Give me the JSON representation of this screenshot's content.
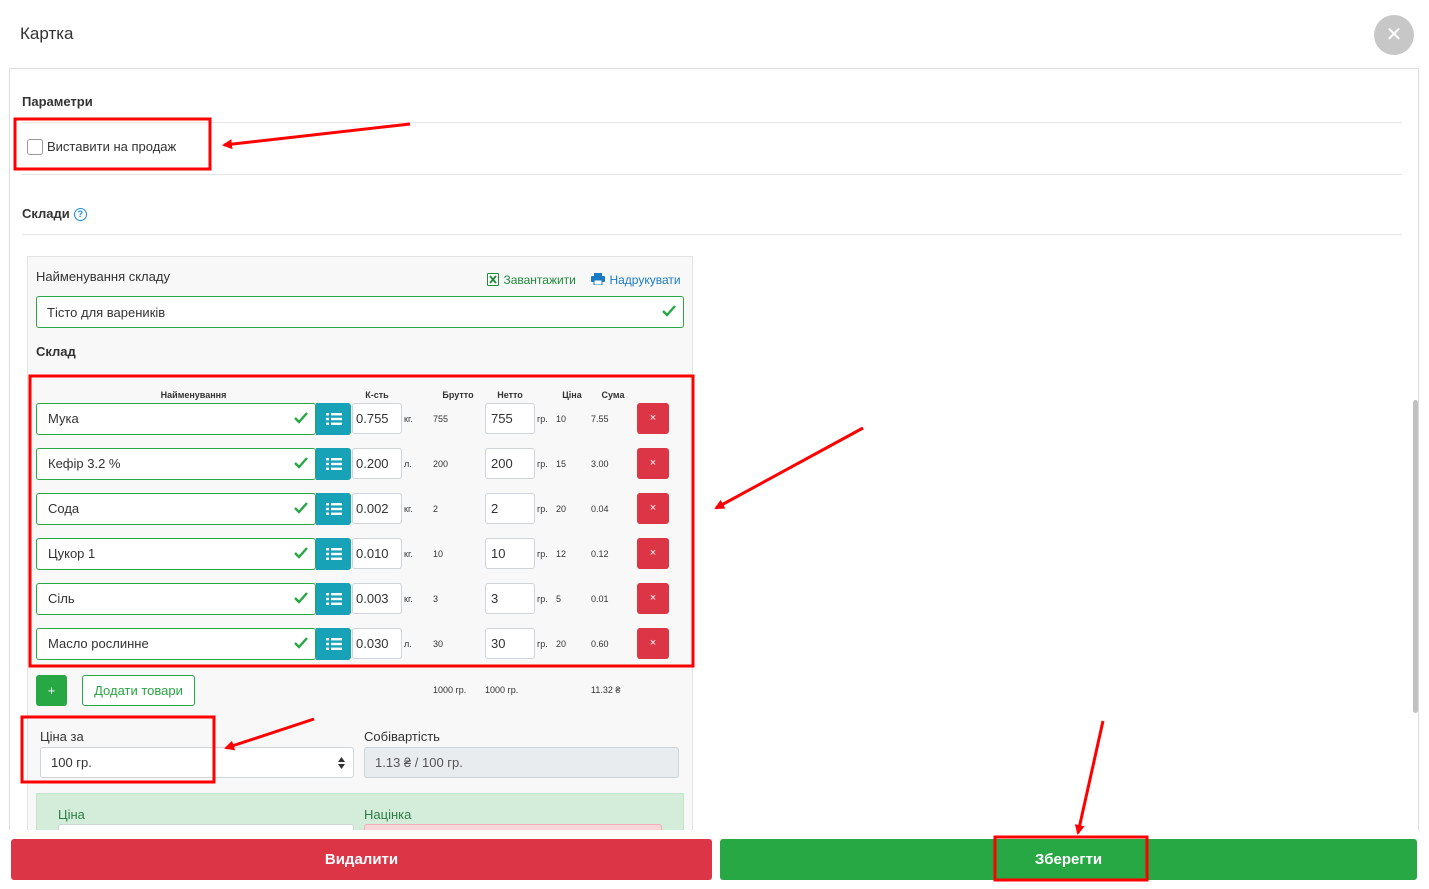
{
  "modal": {
    "title": "Картка",
    "close_icon": "close-icon"
  },
  "params": {
    "title": "Параметри",
    "for_sale_label": "Виставити на продаж",
    "for_sale_checked": false
  },
  "stores": {
    "title": "Склади",
    "card": {
      "name_label": "Найменування складу",
      "download_label": "Завантажити",
      "print_label": "Надрукувати",
      "name_value": "Тісто для вареників",
      "composition_label": "Склад",
      "headers": {
        "name": "Найменування",
        "qty": "К-сть",
        "gross": "Брутто",
        "net": "Нетто",
        "price": "Ціна",
        "sum": "Сума"
      },
      "rows": [
        {
          "name": "Мука",
          "qty": "0.755",
          "unit": "кг.",
          "gross": "755",
          "net": "755",
          "net_unit": "гр.",
          "price": "10",
          "sum": "7.55"
        },
        {
          "name": "Кефір 3.2 %",
          "qty": "0.200",
          "unit": "л.",
          "gross": "200",
          "net": "200",
          "net_unit": "гр.",
          "price": "15",
          "sum": "3.00"
        },
        {
          "name": "Сода",
          "qty": "0.002",
          "unit": "кг.",
          "gross": "2",
          "net": "2",
          "net_unit": "гр.",
          "price": "20",
          "sum": "0.04"
        },
        {
          "name": "Цукор 1",
          "qty": "0.010",
          "unit": "кг.",
          "gross": "10",
          "net": "10",
          "net_unit": "гр.",
          "price": "12",
          "sum": "0.12"
        },
        {
          "name": "Сіль",
          "qty": "0.003",
          "unit": "кг.",
          "gross": "3",
          "net": "3",
          "net_unit": "гр.",
          "price": "5",
          "sum": "0.01"
        },
        {
          "name": "Масло рослинне",
          "qty": "0.030",
          "unit": "л.",
          "gross": "30",
          "net": "30",
          "net_unit": "гр.",
          "price": "20",
          "sum": "0.60"
        }
      ],
      "delete_row_label": "×",
      "add_plus_label": "+",
      "add_goods_label": "Додати товари",
      "totals": {
        "gross": "1000 гр.",
        "net": "1000 гр.",
        "sum": "11.32 ₴"
      },
      "price_per_label": "Ціна за",
      "price_per_value": "100 гр.",
      "cost_label": "Собівартість",
      "cost_value": "1.13 ₴ / 100 гр.",
      "price_label": "Ціна",
      "markup_label": "Націнка"
    }
  },
  "footer": {
    "delete_label": "Видалити",
    "save_label": "Зберегти"
  },
  "colors": {
    "green": "#28a745",
    "red": "#dc3545",
    "teal": "#17a2b8",
    "annotation": "#ff0000"
  }
}
